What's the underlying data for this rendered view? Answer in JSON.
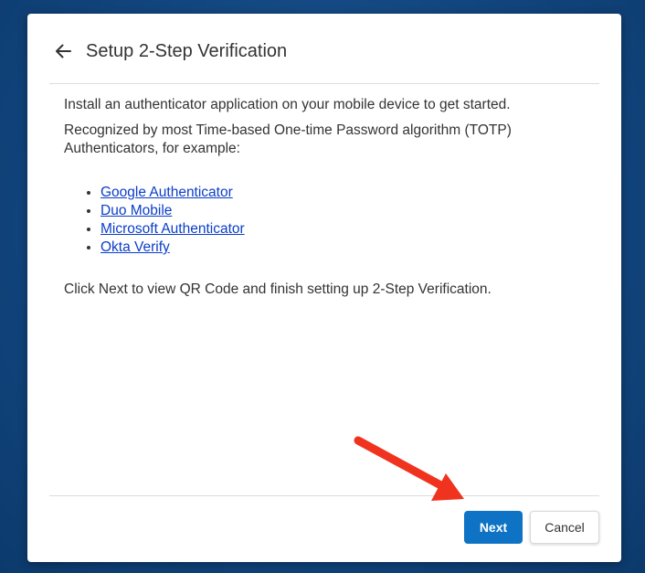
{
  "dialog": {
    "title": "Setup 2-Step Verification",
    "back_icon": "arrow-left-icon"
  },
  "content": {
    "intro": "Install an authenticator application on your mobile device to get started.",
    "examples": "Recognized by most Time-based One-time Password algorithm (TOTP) Authenticators, for example:",
    "apps": [
      {
        "label": "Google Authenticator"
      },
      {
        "label": "Duo Mobile"
      },
      {
        "label": "Microsoft Authenticator"
      },
      {
        "label": "Okta Verify"
      }
    ],
    "instructions": "Click Next to view QR Code and finish setting up 2-Step Verification."
  },
  "footer": {
    "next_label": "Next",
    "cancel_label": "Cancel"
  },
  "colors": {
    "primary_button": "#0e73c4",
    "link": "#0b3ec9",
    "annotation_arrow": "#f0331e",
    "background": "#12467f"
  }
}
